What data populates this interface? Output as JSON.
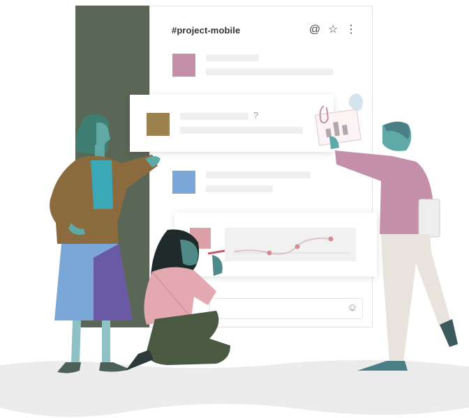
{
  "channel": {
    "title": "#project-mobile",
    "icons": [
      "at-icon",
      "star-icon",
      "more-vertical-icon"
    ]
  },
  "messages": [
    {
      "avatar_color": "#c48fa8"
    },
    {
      "avatar_color": "#9b8250",
      "marker": "?"
    },
    {
      "avatar_color": "#7ba7d8"
    },
    {
      "avatar_color": "#dca0a8"
    }
  ],
  "composer": {
    "icon": "emoji-icon"
  },
  "colors": {
    "sidebar": "#5a6656",
    "accent_pink": "#c48fa8",
    "accent_brown": "#9b8250",
    "accent_blue": "#7ba7d8",
    "accent_rose": "#dca0a8"
  }
}
